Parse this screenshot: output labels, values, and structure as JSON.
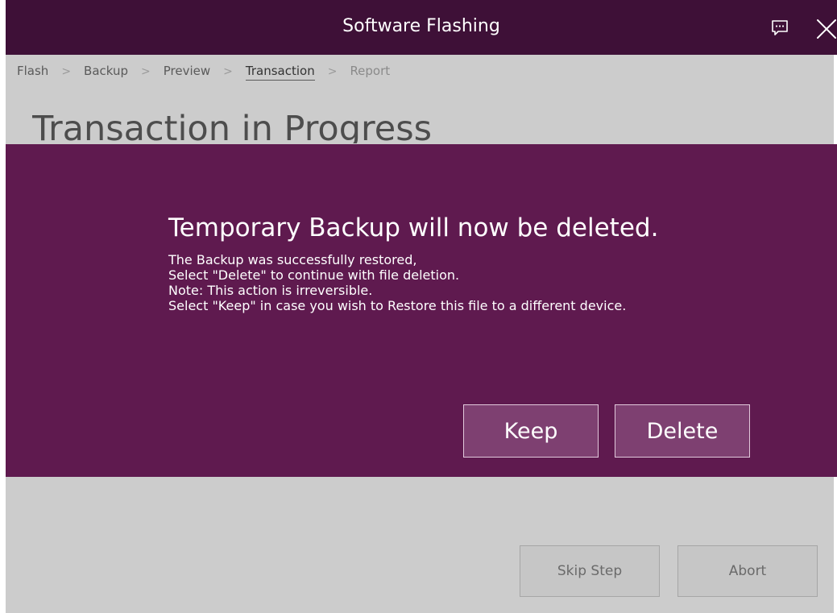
{
  "app": {
    "title": "Software Flashing",
    "icons": {
      "feedback": "feedback-icon",
      "close": "close-icon"
    }
  },
  "breadcrumb": {
    "separator": ">",
    "items": [
      {
        "label": "Flash",
        "state": "visited"
      },
      {
        "label": "Backup",
        "state": "visited"
      },
      {
        "label": "Preview",
        "state": "visited"
      },
      {
        "label": "Transaction",
        "state": "active"
      },
      {
        "label": "Report",
        "state": "disabled"
      }
    ]
  },
  "page": {
    "title": "Transaction in Progress"
  },
  "dialog": {
    "heading": "Temporary Backup will now be deleted.",
    "lines": [
      "The Backup was successfully restored,",
      "Select \"Delete\" to continue with file deletion.",
      "Note: This action is irreversible.",
      "Select \"Keep\" in case you wish to Restore this file to a different device."
    ],
    "keep_label": "Keep",
    "delete_label": "Delete"
  },
  "footer": {
    "skip_label": "Skip Step",
    "abort_label": "Abort"
  },
  "colors": {
    "titlebar": "#3e1037",
    "dialog": "#5f1a4f",
    "dialog_button": "#7e4071",
    "background": "#cccccc"
  }
}
